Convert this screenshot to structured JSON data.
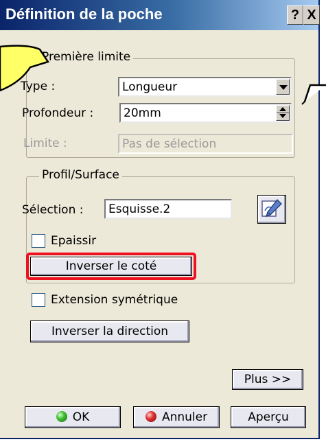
{
  "window": {
    "title": "Définition de la poche",
    "help_label": "?",
    "close_label": "X"
  },
  "first_limit": {
    "legend": "Première limite",
    "type_label": "Type :",
    "type_value": "Longueur",
    "depth_label": "Profondeur :",
    "depth_value": "20mm",
    "limit_label": "Limite :",
    "limit_value": "Pas de sélection"
  },
  "profile": {
    "legend": "Profil/Surface",
    "selection_label": "Sélection :",
    "selection_value": "Esquisse.2",
    "thicken_label": "Epaissir",
    "thicken_checked": false,
    "reverse_side_label": "Inverser le coté"
  },
  "symmetric_label": "Extension symétrique",
  "symmetric_checked": false,
  "reverse_direction_label": "Inverser la direction",
  "more_label": "Plus >>",
  "footer": {
    "ok_label": "OK",
    "cancel_label": "Annuler",
    "preview_label": "Aperçu"
  },
  "colors": {
    "titlebar_start": "#0a246a",
    "titlebar_end": "#a6caf0",
    "dialog_bg": "#ece9d8",
    "highlight_outline": "#ee1122",
    "callout_fill": "#ffff66"
  }
}
